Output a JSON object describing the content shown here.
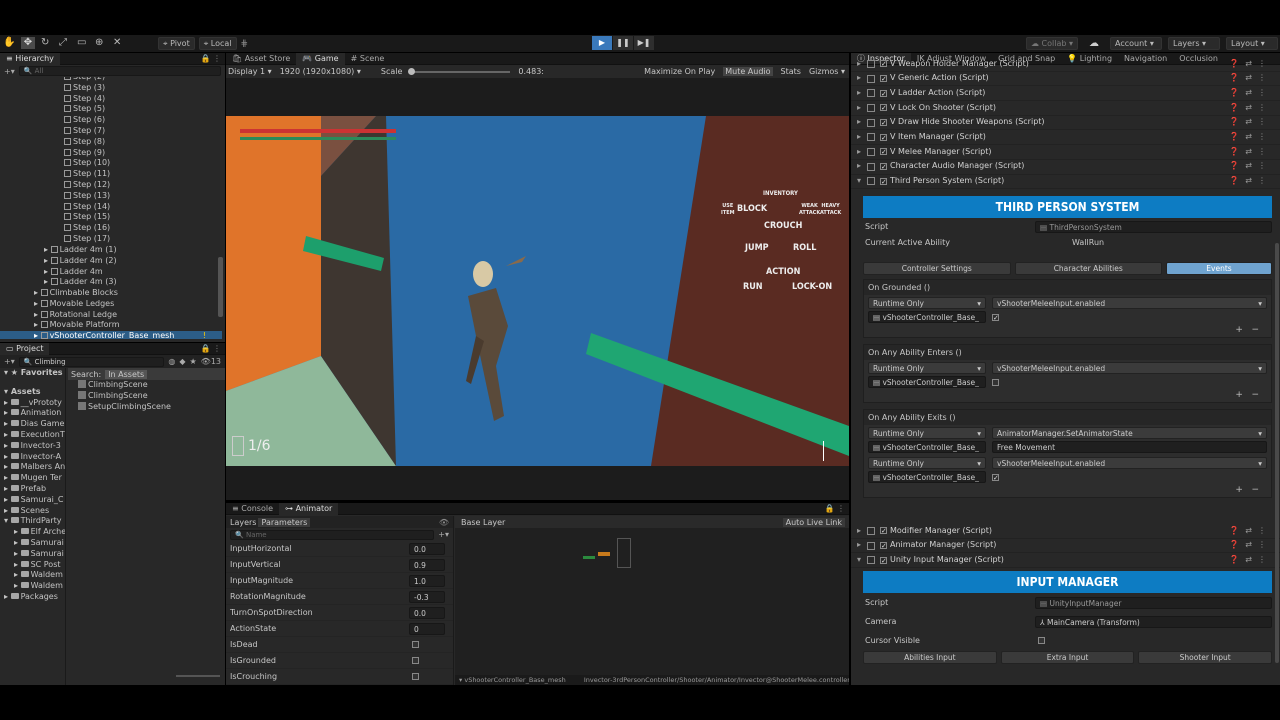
{
  "toolbar": {
    "pivot": "Pivot",
    "local": "Local",
    "collab": "Collab",
    "account": "Account",
    "layers": "Layers",
    "layout": "Layout"
  },
  "hierarchy": {
    "title": "Hierarchy",
    "search_placeholder": "All",
    "items": [
      "Step (2)",
      "Step (3)",
      "Step (4)",
      "Step (5)",
      "Step (6)",
      "Step (7)",
      "Step (8)",
      "Step (9)",
      "Step (10)",
      "Step (11)",
      "Step (12)",
      "Step (13)",
      "Step (14)",
      "Step (15)",
      "Step (16)",
      "Step (17)"
    ],
    "ladders": [
      "Ladder 4m (1)",
      "Ladder 4m (2)",
      "Ladder 4m",
      "Ladder 4m (3)"
    ],
    "groups": [
      "Climbable Blocks",
      "Movable Ledges",
      "Rotational Ledge",
      "Movable Platform"
    ],
    "selected": "vShooterController_Base_mesh"
  },
  "project": {
    "title": "Project",
    "search_value": "Climbing",
    "count": "13",
    "favorites": "Favorites",
    "search_label": "Search:",
    "search_scope": "In Assets",
    "results": [
      "ClimbingScene",
      "ClimbingScene",
      "SetupClimbingScene"
    ],
    "assets_root": "Assets",
    "assets": [
      "__vPrototy",
      "Animation",
      "Dias Game",
      "ExecutionT",
      "Invector-3",
      "Invector-A",
      "Malbers An",
      "Mugen Ter",
      "Prefab",
      "Samurai_C",
      "Scenes"
    ],
    "third_party": "ThirdParty",
    "third_party_children": [
      "Elf Arche",
      "Samurai",
      "Samurai",
      "SC Post",
      "Waldem",
      "Waldem"
    ],
    "packages": "Packages"
  },
  "game": {
    "tabs": [
      "Asset Store",
      "Game",
      "Scene"
    ],
    "display": "Display 1",
    "resolution": "1920 (1920x1080)",
    "scale_label": "Scale",
    "scale_value": "0.483:",
    "options": [
      "Maximize On Play",
      "Mute Audio",
      "Stats",
      "Gizmos"
    ],
    "hud": {
      "inventory": "INVENTORY",
      "use_item_1": "USE",
      "use_item_2": "ITEM",
      "block": "BLOCK",
      "crouch": "CROUCH",
      "weak_1": "WEAK",
      "weak_2": "ATTACK",
      "heavy_1": "HEAVY",
      "heavy_2": "ATTACK",
      "jump": "JUMP",
      "roll": "ROLL",
      "action": "ACTION",
      "run": "RUN",
      "lockon": "LOCK-ON",
      "ammo": "1/6"
    }
  },
  "console": {
    "tabs": [
      "Console",
      "Animator"
    ],
    "subtabs": [
      "Layers",
      "Parameters"
    ],
    "name_placeholder": "Name",
    "base_layer": "Base Layer",
    "auto_live": "Auto Live Link",
    "params": [
      {
        "name": "InputHorizontal",
        "value": "0.0"
      },
      {
        "name": "InputVertical",
        "value": "0.9"
      },
      {
        "name": "InputMagnitude",
        "value": "1.0"
      },
      {
        "name": "RotationMagnitude",
        "value": "-0.3"
      },
      {
        "name": "TurnOnSpotDirection",
        "value": "0.0"
      },
      {
        "name": "ActionState",
        "value": "0"
      },
      {
        "name": "IsDead",
        "value": ""
      },
      {
        "name": "IsGrounded",
        "value": ""
      },
      {
        "name": "IsCrouching",
        "value": ""
      }
    ],
    "footer_object": "vShooterController_Base_mesh",
    "footer_path": "Invector-3rdPersonController/Shooter/Animator/Invector@ShooterMelee.controller"
  },
  "inspector": {
    "tabs": [
      "Inspector",
      "IK Adjust Window",
      "Grid and Snap",
      "Lighting",
      "Navigation",
      "Occlusion"
    ],
    "components_top": [
      "V Weapon Holder Manager (Script)",
      "V Generic Action (Script)",
      "V Ladder Action (Script)",
      "V Lock On Shooter (Script)",
      "V Draw Hide Shooter Weapons (Script)",
      "V Item Manager (Script)",
      "V Melee Manager (Script)",
      "Character Audio Manager (Script)",
      "Third Person System (Script)"
    ],
    "tps_banner": "THIRD PERSON SYSTEM",
    "script_label": "Script",
    "tps_script": "ThirdPersonSystem",
    "active_ability_label": "Current Active Ability",
    "active_ability": "WallRun",
    "tps_tabs": [
      "Controller Settings",
      "Character Abilities",
      "Events"
    ],
    "events": [
      {
        "title": "On Grounded ()",
        "rows": [
          {
            "mode": "Runtime Only",
            "func": "vShooterMeleeInput.enabled",
            "obj": "vShooterController_Base_",
            "arg": "✓"
          }
        ]
      },
      {
        "title": "On Any Ability Enters ()",
        "rows": [
          {
            "mode": "Runtime Only",
            "func": "vShooterMeleeInput.enabled",
            "obj": "vShooterController_Base_",
            "arg": ""
          }
        ]
      },
      {
        "title": "On Any Ability Exits ()",
        "rows": [
          {
            "mode": "Runtime Only",
            "func": "AnimatorManager.SetAnimatorState",
            "obj": "vShooterController_Base_",
            "arg": "Free Movement"
          },
          {
            "mode": "Runtime Only",
            "func": "vShooterMeleeInput.enabled",
            "obj": "vShooterController_Base_",
            "arg": "✓"
          }
        ]
      }
    ],
    "components_bottom": [
      "Modifier Manager (Script)",
      "Animator Manager (Script)",
      "Unity Input Manager (Script)"
    ],
    "input_banner": "INPUT MANAGER",
    "input_script": "UnityInputManager",
    "camera_label": "Camera",
    "camera_value": "MainCamera (Transform)",
    "cursor_label": "Cursor Visible",
    "input_buttons": [
      "Abilities Input",
      "Extra Input",
      "Shooter Input"
    ]
  }
}
